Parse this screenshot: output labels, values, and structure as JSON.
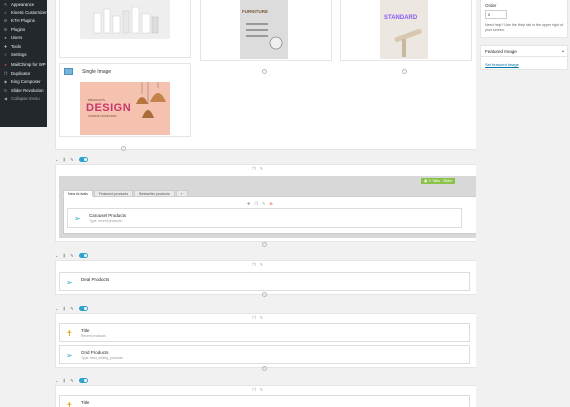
{
  "sidebar": {
    "items": [
      {
        "label": "Appearance",
        "icon": "brush-icon",
        "dim": false
      },
      {
        "label": "Kinetic Customizer",
        "icon": "customize-icon",
        "dim": false
      },
      {
        "label": "KTH Plugins",
        "icon": "plugin-icon",
        "dim": false
      },
      {
        "label": "Plugins",
        "icon": "plugin-icon",
        "dim": false
      },
      {
        "label": "Users",
        "icon": "user-icon",
        "dim": false
      },
      {
        "label": "Tools",
        "icon": "wrench-icon",
        "dim": false
      },
      {
        "label": "Settings",
        "icon": "settings-icon",
        "dim": false
      },
      {
        "label": "MailChimp for WP",
        "icon": "mailchimp-icon",
        "dim": false
      },
      {
        "label": "Duplicator",
        "icon": "duplicator-icon",
        "dim": false
      },
      {
        "label": "King Composer",
        "icon": "composer-icon",
        "dim": false
      },
      {
        "label": "Slider Revolution",
        "icon": "slider-icon",
        "dim": false
      },
      {
        "label": "Collapse menu",
        "icon": "collapse-icon",
        "dim": true
      }
    ]
  },
  "top_section": {
    "single_image_label": "Single Image",
    "design_card": {
      "top": "PRODUCTS",
      "big": "DESIGN",
      "sub": "ULTIMATE COLOR FROM"
    },
    "furniture_label": "FURNITURE",
    "standard_label": "STANDARD"
  },
  "right_panel": {
    "order_label": "Order",
    "order_value": "0",
    "help_text": "Need help? Use the Help tab in the upper right of your screen.",
    "featured_image_title": "Featured Image",
    "featured_image_link": "Set featured image"
  },
  "row1": {
    "tabs": [
      "New Arrivals",
      "Featured products",
      "Bestseller products",
      "+"
    ],
    "green_label": "Tabs - Slider",
    "element": {
      "title": "Carousel Products",
      "sub": "Type: recent products"
    }
  },
  "row2": {
    "element": {
      "title": "Deal Products",
      "sub": ""
    }
  },
  "row3": {
    "elements": [
      {
        "title": "Title",
        "sub": "Recent products"
      },
      {
        "title": "Grid Products",
        "sub": "Type: best_selling_products"
      }
    ]
  },
  "row4": {
    "element": {
      "title": "Title",
      "sub": ""
    }
  },
  "colors": {
    "accent": "#2ea2cc",
    "green": "#8bc34a",
    "danger": "#e74c3c",
    "sidebar": "#23282d"
  }
}
